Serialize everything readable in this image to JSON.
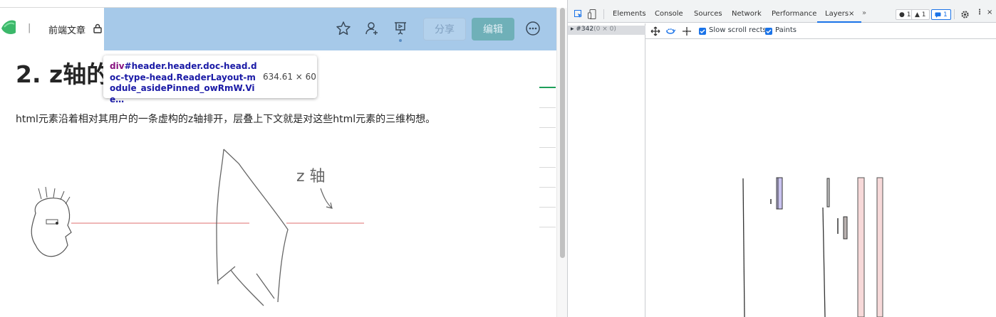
{
  "page": {
    "breadcrumb_sep": "|",
    "breadcrumb_label": "前端文章",
    "share_label": "分享",
    "edit_label": "编辑",
    "article_title": "2. z轴的",
    "paragraph": "html元素沿着相对其用户的一条虚构的z轴排开，层叠上下文就是对这些html元素的三维构想。",
    "sketch_label": "z 轴",
    "highlight_color": "#6fa8dc"
  },
  "tooltip": {
    "tag": "div",
    "selector": "#header.header.doc-head.doc-type-head.ReaderLayout-module_asidePinned_owRmW.Vie…",
    "size": "634.61 × 60"
  },
  "devtools": {
    "tabs": [
      "Elements",
      "Console",
      "Sources",
      "Network",
      "Performance"
    ],
    "active_tab": "Layers",
    "more_tabs": "»",
    "badges": {
      "errors": "● 1",
      "warnings": "▲ 1",
      "messages": "1"
    },
    "layer_row": {
      "name": "#342",
      "dims": "(0 × 0)"
    },
    "toolbar": {
      "slow_scroll_label": "Slow scroll rects",
      "paints_label": "Paints"
    }
  }
}
